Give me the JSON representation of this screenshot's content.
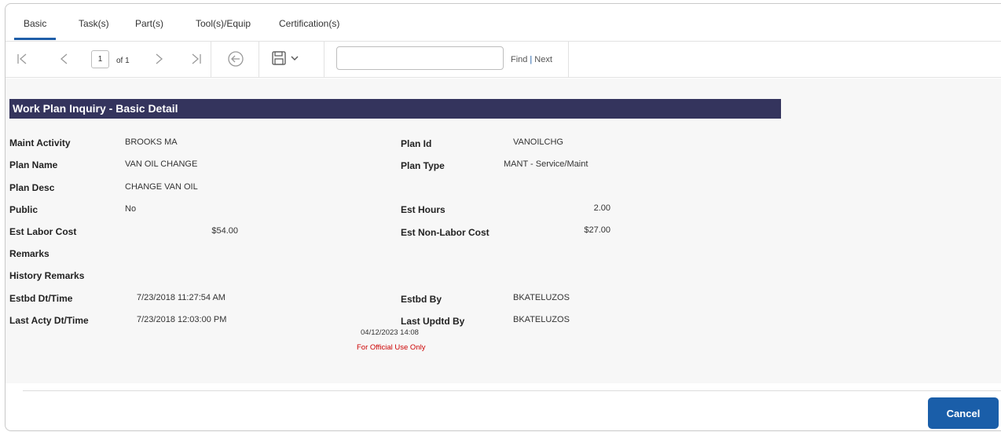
{
  "tabs": [
    {
      "label": "Basic",
      "active": true
    },
    {
      "label": "Task(s)",
      "active": false
    },
    {
      "label": "Part(s)",
      "active": false
    },
    {
      "label": "Tool(s)/Equip",
      "active": false
    },
    {
      "label": "Certification(s)",
      "active": false
    }
  ],
  "toolbar": {
    "current_page": "1",
    "of_text": "of 1",
    "find_value": "",
    "find_label": "Find",
    "separator": "|",
    "next_label": "Next",
    "icons": [
      "first-page-icon",
      "prev-page-icon",
      "next-page-icon",
      "last-page-icon",
      "back-circle-icon",
      "save-icon",
      "chevron-down-icon"
    ]
  },
  "report": {
    "title": "Work Plan Inquiry - Basic Detail",
    "fields_left": [
      {
        "label": "Maint Activity",
        "value": "BROOKS MA"
      },
      {
        "label": "Plan Name",
        "value": "VAN OIL CHANGE"
      },
      {
        "label": "Plan Desc",
        "value": "CHANGE VAN OIL"
      },
      {
        "label": "Public",
        "value": "No"
      },
      {
        "label": "Est Labor Cost",
        "value": "$54.00"
      },
      {
        "label": "Remarks",
        "value": ""
      },
      {
        "label": "History Remarks",
        "value": ""
      },
      {
        "label": "Estbd Dt/Time",
        "value": "7/23/2018 11:27:54 AM"
      },
      {
        "label": "Last Acty Dt/Time",
        "value": "7/23/2018 12:03:00 PM"
      }
    ],
    "fields_right": [
      {
        "label": "Plan Id",
        "value": "VANOILCHG"
      },
      {
        "label": "Plan Type",
        "value": "MANT - Service/Maint"
      },
      {
        "label": "Est Hours",
        "value": "2.00"
      },
      {
        "label": "Est Non-Labor Cost",
        "value": "$27.00"
      },
      {
        "label": "Estbd By",
        "value": "BKATELUZOS"
      },
      {
        "label": "Last Updtd By",
        "value": "BKATELUZOS"
      }
    ],
    "print_timestamp": "04/12/2023 14:08",
    "footer_notice": "For Official Use Only"
  },
  "actions": {
    "cancel_label": "Cancel"
  },
  "colors": {
    "banner": "#34345d",
    "accent": "#1a5ea9",
    "notice": "#cc0000"
  }
}
